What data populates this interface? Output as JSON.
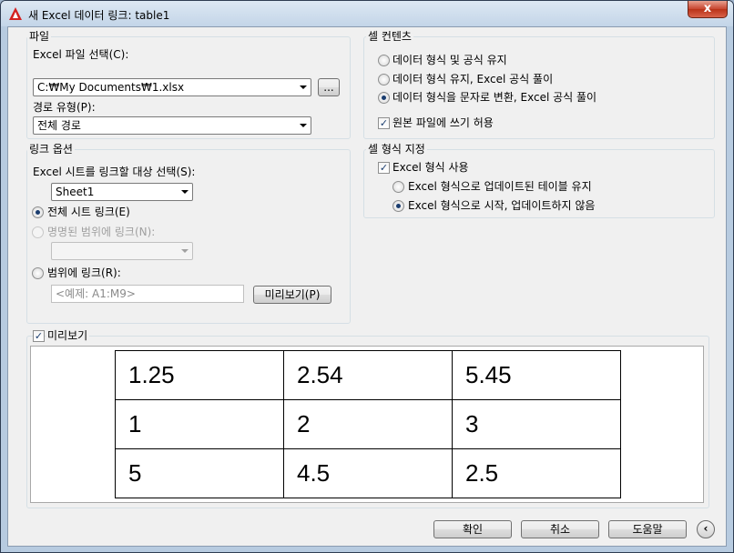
{
  "window": {
    "title": "새 Excel 데이터 링크: table1",
    "close_glyph": "x"
  },
  "file": {
    "legend": "파일",
    "select_label": "Excel 파일 선택(C):",
    "file_value": "C:₩My Documents₩1.xlsx",
    "browse_label": "...",
    "path_type_label": "경로 유형(P):",
    "path_type_value": "전체 경로"
  },
  "link_options": {
    "legend": "링크 옵션",
    "sheet_select_label": "Excel 시트를 링크할 대상 선택(S):",
    "sheet_value": "Sheet1",
    "link_entire_sheet": "전체 시트 링크(E)",
    "link_named_range": "명명된 범위에 링크(N):",
    "named_range_value": "",
    "link_range": "범위에 링크(R):",
    "range_placeholder": "<예제: A1:M9>",
    "preview_button": "미리보기(P)",
    "selected_option": "link_entire_sheet"
  },
  "cell_contents": {
    "legend": "셀 컨텐츠",
    "keep_format_formula": "데이터 형식 및 공식 유지",
    "keep_format_solve_formula": "데이터 형식 유지, Excel 공식 풀이",
    "convert_text_solve_formula": "데이터 형식을 문자로 변환, Excel 공식 풀이",
    "allow_write": "원본 파일에 쓰기 허용",
    "allow_write_checked": true,
    "selected_option": "convert_text_solve_formula"
  },
  "cell_format": {
    "legend": "셀 형식 지정",
    "use_excel_format": "Excel 형식 사용",
    "use_excel_format_checked": true,
    "keep_updated_table": "Excel 형식으로 업데이트된 테이블 유지",
    "start_no_update": "Excel 형식으로 시작, 업데이트하지 않음",
    "selected_option": "start_no_update"
  },
  "preview": {
    "label": "미리보기",
    "checked": true,
    "rows": [
      [
        "1.25",
        "2.54",
        "5.45"
      ],
      [
        "1",
        "2",
        "3"
      ],
      [
        "5",
        "4.5",
        "2.5"
      ]
    ]
  },
  "buttons": {
    "ok": "확인",
    "cancel": "취소",
    "help": "도움말",
    "collapse": "‹"
  },
  "colors": {
    "accent": "#1a3d6f",
    "title_bar": "#c3d5e8",
    "close_button": "#c7452e",
    "autocad_red": "#d32020"
  }
}
